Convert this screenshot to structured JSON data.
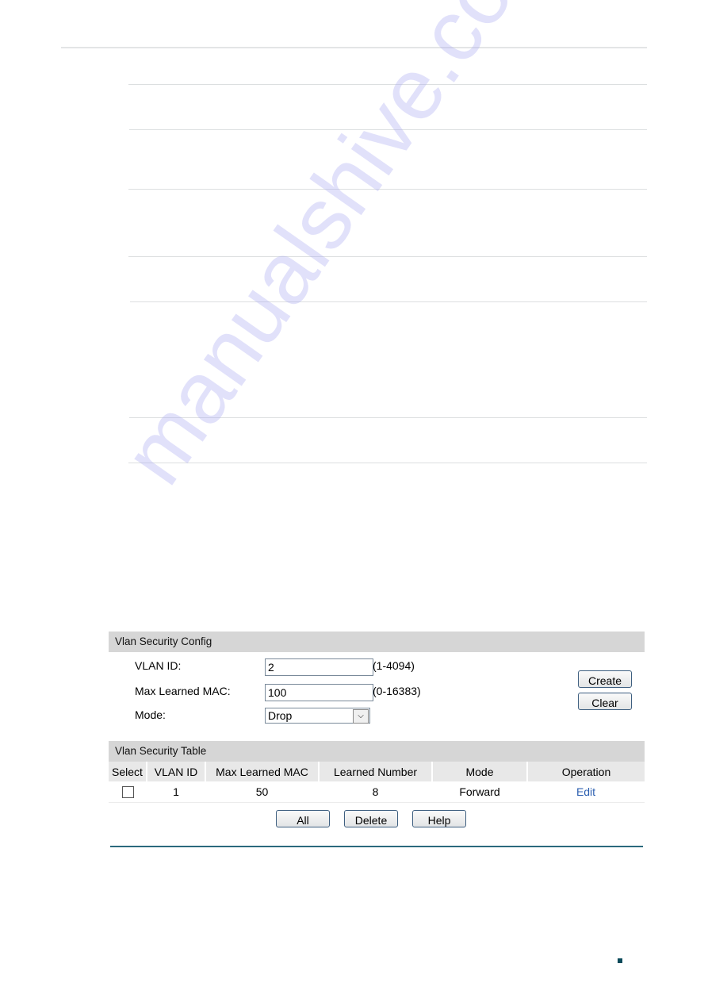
{
  "watermark": "manualshive.com",
  "config_panel": {
    "title": "Vlan Security Config",
    "fields": [
      {
        "label": "VLAN ID:",
        "value": "2",
        "hint": "(1-4094)"
      },
      {
        "label": "Max Learned MAC:",
        "value": "100",
        "hint": "(0-16383)"
      }
    ],
    "mode": {
      "label": "Mode:",
      "selected": "Drop"
    },
    "buttons": {
      "create": "Create",
      "clear": "Clear"
    }
  },
  "table_panel": {
    "title": "Vlan Security Table",
    "columns": [
      "Select",
      "VLAN ID",
      "Max Learned MAC",
      "Learned Number",
      "Mode",
      "Operation"
    ],
    "rows": [
      {
        "selected": false,
        "vlan_id": "1",
        "max_learned_mac": "50",
        "learned_number": "8",
        "mode": "Forward",
        "operation": "Edit"
      }
    ],
    "buttons": {
      "all": "All",
      "delete": "Delete",
      "help": "Help"
    }
  },
  "colors": {
    "accent_rule": "#2b6a7d",
    "link": "#2c5fb0",
    "header_bg": "#d6d6d6"
  }
}
